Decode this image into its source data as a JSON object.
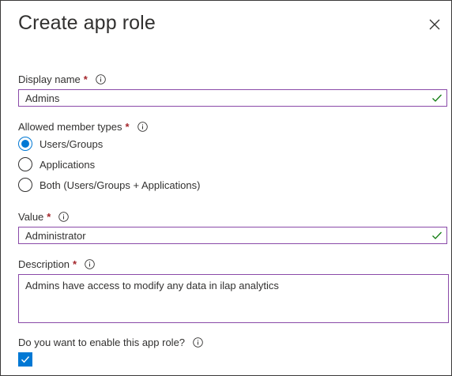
{
  "dialog": {
    "title": "Create app role"
  },
  "display_name": {
    "label": "Display name",
    "required_marker": "*",
    "value": "Admins"
  },
  "member_types": {
    "label": "Allowed member types",
    "required_marker": "*",
    "options": [
      {
        "label": "Users/Groups",
        "selected": true
      },
      {
        "label": "Applications",
        "selected": false
      },
      {
        "label": "Both (Users/Groups + Applications)",
        "selected": false
      }
    ]
  },
  "value_field": {
    "label": "Value",
    "required_marker": "*",
    "value": "Administrator"
  },
  "description": {
    "label": "Description",
    "required_marker": "*",
    "value": "Admins have access to modify any data in ilap analytics"
  },
  "enable": {
    "label": "Do you want to enable this app role?",
    "checked": true
  },
  "icons": {
    "close": "close-icon",
    "info": "info-icon",
    "valid": "checkmark-icon"
  },
  "colors": {
    "accent": "#0078d4",
    "required": "#a4262c",
    "valid": "#107c10",
    "focus_border": "#8a4aa8"
  }
}
